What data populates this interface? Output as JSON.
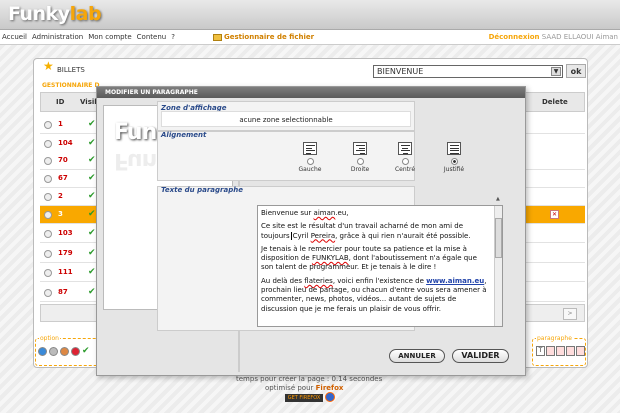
{
  "app": {
    "logo_main": "Funky",
    "logo_accent": "lab"
  },
  "menu": {
    "items": [
      "Accueil",
      "Administration",
      "Mon compte",
      "Contenu",
      "?"
    ],
    "file_manager": "Gestionnaire de fichier",
    "logout": "Déconnexion",
    "user": "SAAD ELLAOUI Aiman"
  },
  "billets": {
    "title": "BILLETS",
    "select_value": "BIENVENUE",
    "ok": "ok",
    "manager_label": "GESTIONNAIRE D",
    "columns": {
      "id": "ID",
      "visible": "Visib",
      "delete": "Delete"
    },
    "rows": [
      {
        "id": "1",
        "selected": false
      },
      {
        "id": "104",
        "selected": false
      },
      {
        "id": "70",
        "selected": false
      },
      {
        "id": "67",
        "selected": false
      },
      {
        "id": "2",
        "selected": false
      },
      {
        "id": "3",
        "selected": true
      },
      {
        "id": "103",
        "selected": false
      },
      {
        "id": "179",
        "selected": false
      },
      {
        "id": "111",
        "selected": false
      },
      {
        "id": "87",
        "selected": false
      }
    ],
    "pager": ">"
  },
  "option": {
    "label": "option"
  },
  "paragraphe": {
    "label": "paragraphe"
  },
  "footer": {
    "line1": "temps pour créer la page : 0.14 secondes",
    "line2_prefix": "optimisé pour",
    "line2_link": "Firefox",
    "badge": "GET FIREFOX"
  },
  "modal": {
    "title": "MODIFIER UN PARAGRAPHE",
    "zone_label": "Zone d'affichage",
    "zone_value": "acune zone selectionnable",
    "align_label": "Alignement",
    "align_options": [
      {
        "label": "Gauche",
        "checked": false
      },
      {
        "label": "Droite",
        "checked": false
      },
      {
        "label": "Centré",
        "checked": false
      },
      {
        "label": "Justifié",
        "checked": true
      }
    ],
    "text_label": "Texte du paragraphe",
    "cancel": "ANNULER",
    "validate": "VALIDER"
  },
  "colors": {
    "accent": "#f6a60a",
    "selected_row": "#f9a800",
    "link": "#2244aa"
  }
}
